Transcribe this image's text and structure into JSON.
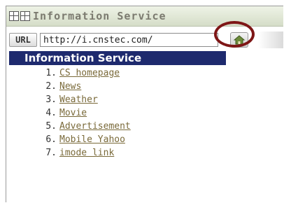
{
  "title": "Information Service",
  "url_bar": {
    "button_label": "URL",
    "value": "http://i.cnstec.com/"
  },
  "header": "Information Service",
  "menu": [
    {
      "num": "1.",
      "label": "CS homepage"
    },
    {
      "num": "2.",
      "label": "News"
    },
    {
      "num": "3.",
      "label": "Weather"
    },
    {
      "num": "4.",
      "label": "Movie"
    },
    {
      "num": "5.",
      "label": "Advertisement"
    },
    {
      "num": "6.",
      "label": "Mobile Yahoo"
    },
    {
      "num": "7.",
      "label": "imode link"
    }
  ],
  "icons": {
    "app": "grid-icon",
    "home": "home-icon"
  },
  "colors": {
    "header_bg": "#1e2a6e",
    "link": "#7a6a3a",
    "highlight_ring": "#7e1616"
  }
}
